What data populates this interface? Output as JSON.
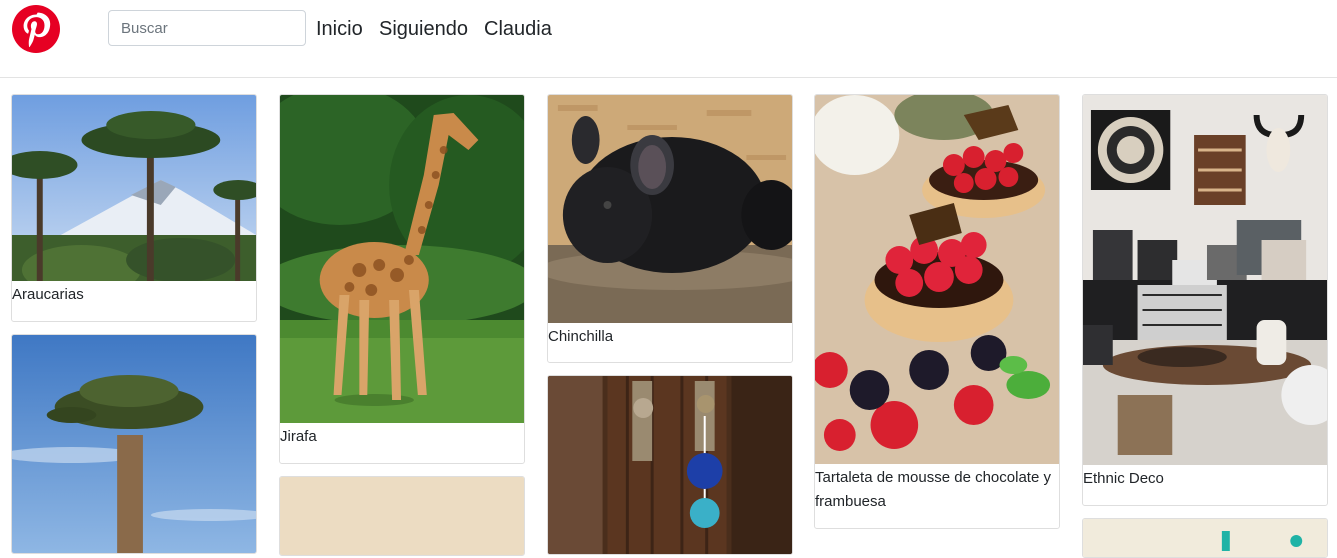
{
  "brand": {
    "icon": "pinterest-logo-icon",
    "color": "#e60023"
  },
  "search": {
    "placeholder": "Buscar"
  },
  "nav": [
    "Inicio",
    "Siguiendo",
    "Claudia"
  ],
  "pins": [
    {
      "caption": "Araucarias",
      "image": "araucaria-trees-volcano-photo"
    },
    {
      "caption": "",
      "image": "baobab-tree-photo"
    },
    {
      "caption": "Jirafa",
      "image": "giraffe-photo"
    },
    {
      "caption": "",
      "image": "beige-pin-photo"
    },
    {
      "caption": "Chinchilla",
      "image": "chinchilla-photo"
    },
    {
      "caption": "",
      "image": "door-pompoms-photo"
    },
    {
      "caption": "Tartaleta de mousse de chocolate y frambuesa",
      "image": "raspberry-tart-photo"
    },
    {
      "caption": "Ethnic Deco",
      "image": "ethnic-living-room-photo"
    },
    {
      "caption": "",
      "image": "teal-pin-photo"
    }
  ]
}
